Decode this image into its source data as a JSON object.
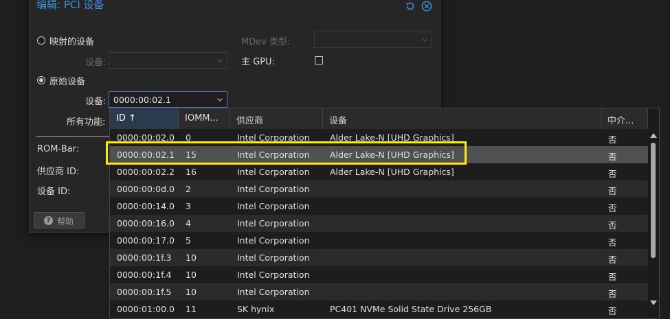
{
  "dialog": {
    "title": "编辑: PCI 设备",
    "mapped_device_label": "映射的设备",
    "mapped_device_field_label": "设备:",
    "mdev_type_label": "MDev 类型:",
    "primary_gpu_label": "主 GPU:",
    "raw_device_label": "原始设备",
    "raw_device_field_label": "设备:",
    "raw_device_value": "0000:00:02.1",
    "all_functions_label": "所有功能:",
    "rombar_label": "ROM-Bar:",
    "vendor_id_label": "供应商 ID:",
    "device_id_label": "设备 ID:",
    "help_label": "帮助"
  },
  "grid": {
    "columns": [
      "ID ↑",
      "IOMM...",
      "供应商",
      "设备",
      "中介..."
    ],
    "rows": [
      {
        "id": "0000:00:02.0",
        "iommu": "0",
        "vendor": "Intel Corporation",
        "device": "Alder Lake-N [UHD Graphics]",
        "mdev": "否"
      },
      {
        "id": "0000:00:02.1",
        "iommu": "15",
        "vendor": "Intel Corporation",
        "device": "Alder Lake-N [UHD Graphics]",
        "mdev": "否"
      },
      {
        "id": "0000:00:02.2",
        "iommu": "16",
        "vendor": "Intel Corporation",
        "device": "Alder Lake-N [UHD Graphics]",
        "mdev": "否"
      },
      {
        "id": "0000:00:0d.0",
        "iommu": "2",
        "vendor": "Intel Corporation",
        "device": "",
        "mdev": "否"
      },
      {
        "id": "0000:00:14.0",
        "iommu": "3",
        "vendor": "Intel Corporation",
        "device": "",
        "mdev": "否"
      },
      {
        "id": "0000:00:16.0",
        "iommu": "4",
        "vendor": "Intel Corporation",
        "device": "",
        "mdev": "否"
      },
      {
        "id": "0000:00:17.0",
        "iommu": "5",
        "vendor": "Intel Corporation",
        "device": "",
        "mdev": "否"
      },
      {
        "id": "0000:00:1f.3",
        "iommu": "10",
        "vendor": "Intel Corporation",
        "device": "",
        "mdev": "否"
      },
      {
        "id": "0000:00:1f.4",
        "iommu": "10",
        "vendor": "Intel Corporation",
        "device": "",
        "mdev": "否"
      },
      {
        "id": "0000:00:1f.5",
        "iommu": "10",
        "vendor": "Intel Corporation",
        "device": "",
        "mdev": "否"
      },
      {
        "id": "0000:01:00.0",
        "iommu": "11",
        "vendor": "SK hynix",
        "device": "PC401 NVMe Solid State Drive 256GB",
        "mdev": "否"
      }
    ],
    "selected_index": 1
  },
  "colors": {
    "accent": "#3f8fd5",
    "highlight": "#ffee00"
  }
}
